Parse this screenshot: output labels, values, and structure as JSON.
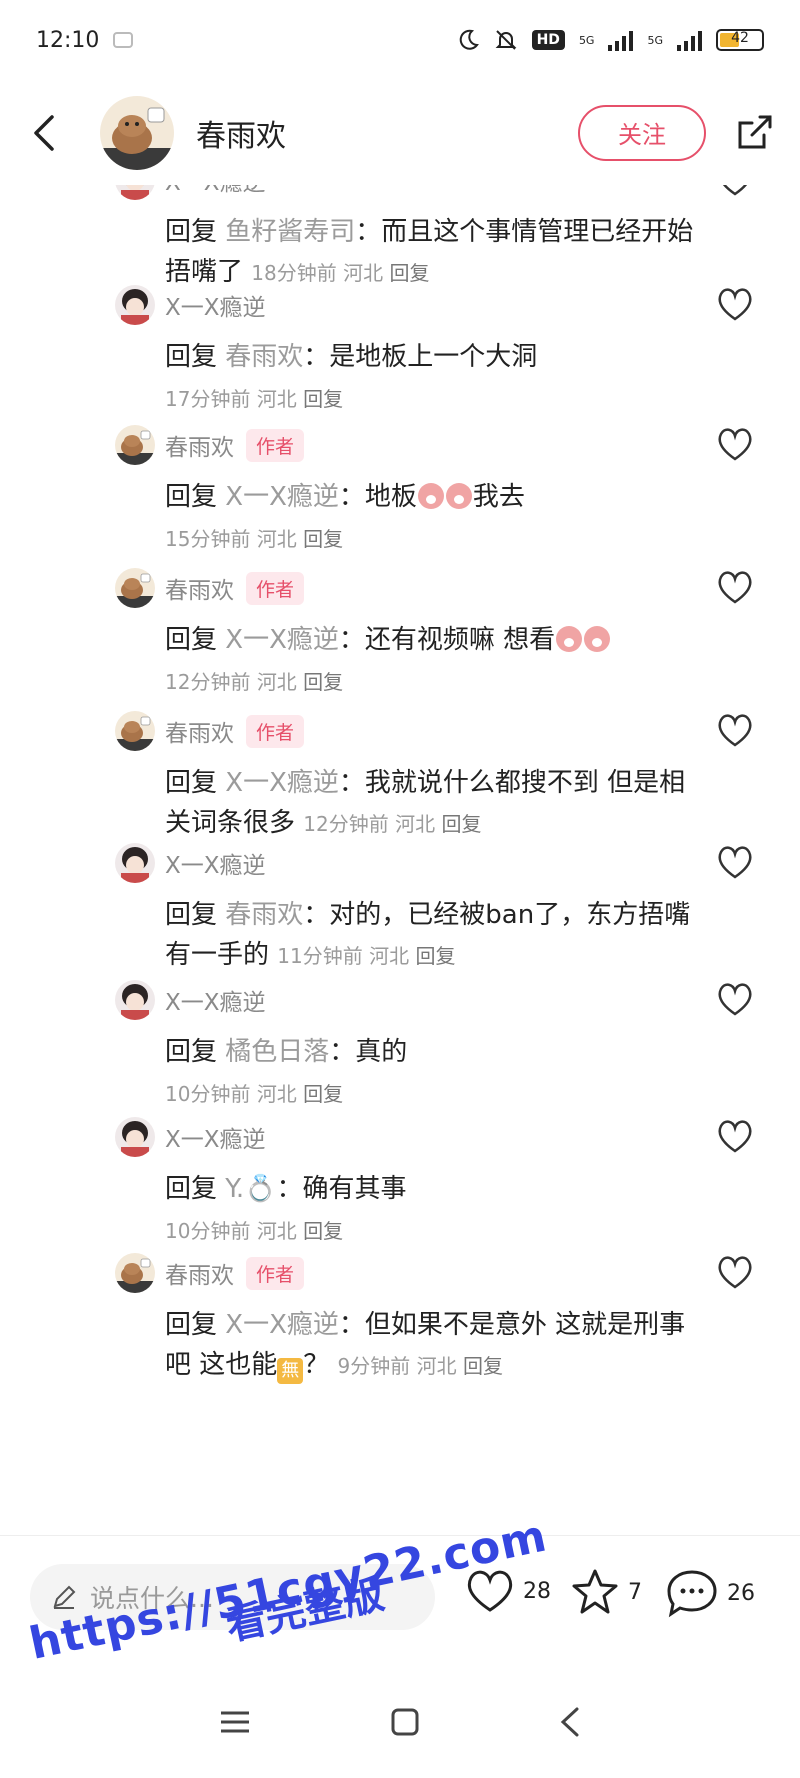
{
  "status_bar": {
    "time": "12:10",
    "hd_label": "HD",
    "signal_1": "5G",
    "signal_2": "5G",
    "battery": "42"
  },
  "header": {
    "title": "春雨欢",
    "follow_label": "关注"
  },
  "comments": [
    {
      "name": "X一X瘾逆",
      "avatar": "girl-avatar",
      "is_author": false,
      "reply_word": "回复",
      "target": "鱼籽酱寿司",
      "text": "：而且这个事情管理已经开始捂嘴了",
      "time": "18分钟前",
      "location": "河北",
      "reply_label": "回复",
      "meta_inline": true
    },
    {
      "name": "X一X瘾逆",
      "avatar": "girl-avatar",
      "is_author": false,
      "reply_word": "回复",
      "target": "春雨欢",
      "text": "：是地板上一个大洞",
      "time": "17分钟前",
      "location": "河北",
      "reply_label": "回复",
      "meta_inline": false
    },
    {
      "name": "春雨欢",
      "avatar": "capybara-avatar",
      "is_author": true,
      "author_tag": "作者",
      "reply_word": "回复",
      "target": "X一X瘾逆",
      "text": "：地板",
      "text_after": "我去",
      "emoji_count": 2,
      "time": "15分钟前",
      "location": "河北",
      "reply_label": "回复",
      "meta_inline": false
    },
    {
      "name": "春雨欢",
      "avatar": "capybara-avatar",
      "is_author": true,
      "author_tag": "作者",
      "reply_word": "回复",
      "target": "X一X瘾逆",
      "text": "：还有视频嘛 想看",
      "emoji_count": 2,
      "time": "12分钟前",
      "location": "河北",
      "reply_label": "回复",
      "meta_inline": false
    },
    {
      "name": "春雨欢",
      "avatar": "capybara-avatar",
      "is_author": true,
      "author_tag": "作者",
      "reply_word": "回复",
      "target": "X一X瘾逆",
      "text": "：我就说什么都搜不到 但是相关词条很多",
      "time": "12分钟前",
      "location": "河北",
      "reply_label": "回复",
      "meta_inline": true
    },
    {
      "name": "X一X瘾逆",
      "avatar": "girl-avatar",
      "is_author": false,
      "reply_word": "回复",
      "target": "春雨欢",
      "text": "：对的，已经被ban了，东方捂嘴有一手的",
      "time": "11分钟前",
      "location": "河北",
      "reply_label": "回复",
      "meta_inline": true
    },
    {
      "name": "X一X瘾逆",
      "avatar": "girl-avatar",
      "is_author": false,
      "reply_word": "回复",
      "target": "橘色日落",
      "text": "：真的",
      "time": "10分钟前",
      "location": "河北",
      "reply_label": "回复",
      "meta_inline": false
    },
    {
      "name": "X一X瘾逆",
      "avatar": "girl-avatar",
      "is_author": false,
      "reply_word": "回复",
      "target": "Y.💍",
      "text": "：确有其事",
      "time": "10分钟前",
      "location": "河北",
      "reply_label": "回复",
      "meta_inline": false
    },
    {
      "name": "春雨欢",
      "avatar": "capybara-avatar",
      "is_author": true,
      "author_tag": "作者",
      "reply_word": "回复",
      "target": "X一X瘾逆",
      "text": "：但如果不是意外 这就是刑事吧 这也能",
      "box_emoji": "無",
      "text_after": "？",
      "time": "9分钟前",
      "location": "河北",
      "reply_label": "回复",
      "meta_inline": true
    }
  ],
  "bottom_bar": {
    "input_placeholder": "说点什么...",
    "like_count": "28",
    "star_count": "7",
    "comment_count": "26"
  },
  "watermark": {
    "line1": "https://51cgy22.com",
    "line2": "看完整版"
  },
  "colors": {
    "accent": "#e6506a",
    "watermark": "#3546e0",
    "meta_gray": "#9b9b9b"
  }
}
